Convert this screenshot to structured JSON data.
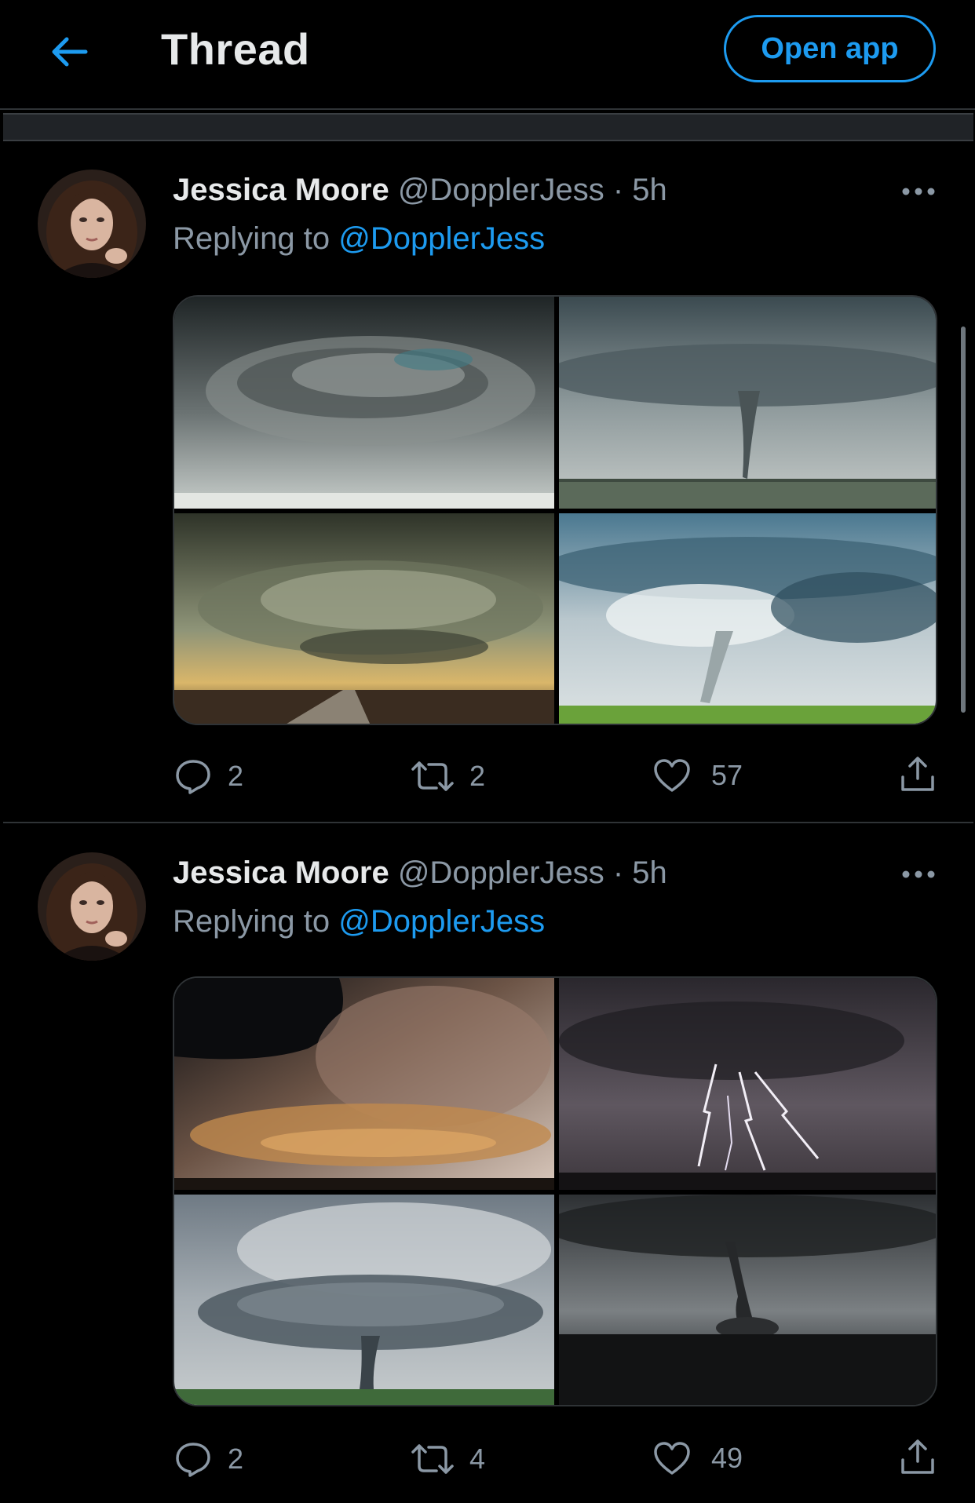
{
  "header": {
    "title": "Thread",
    "open_app_label": "Open app",
    "back_icon": "arrow-left-icon"
  },
  "colors": {
    "accent": "#1d9bf0",
    "background": "#000000",
    "muted": "#8b98a5",
    "text": "#e7e9ea"
  },
  "tweets": [
    {
      "name": "Jessica Moore",
      "handle": "@DopplerJess · 5h",
      "replying_prefix": "Replying to ",
      "replying_to": "@DopplerJess",
      "photos": [
        "supercell-storm-photo",
        "tornado-plains-photo",
        "supercell-road-photo",
        "tornado-blue-sky-photo"
      ],
      "replies": "2",
      "retweets": "2",
      "likes": "57"
    },
    {
      "name": "Jessica Moore",
      "handle": "@DopplerJess · 5h",
      "replying_prefix": "Replying to ",
      "replying_to": "@DopplerJess",
      "photos": [
        "sunset-supercell-photo",
        "lightning-storm-photo",
        "mothership-supercell-photo",
        "dark-tornado-photo"
      ],
      "replies": "2",
      "retweets": "4",
      "likes": "49"
    }
  ]
}
